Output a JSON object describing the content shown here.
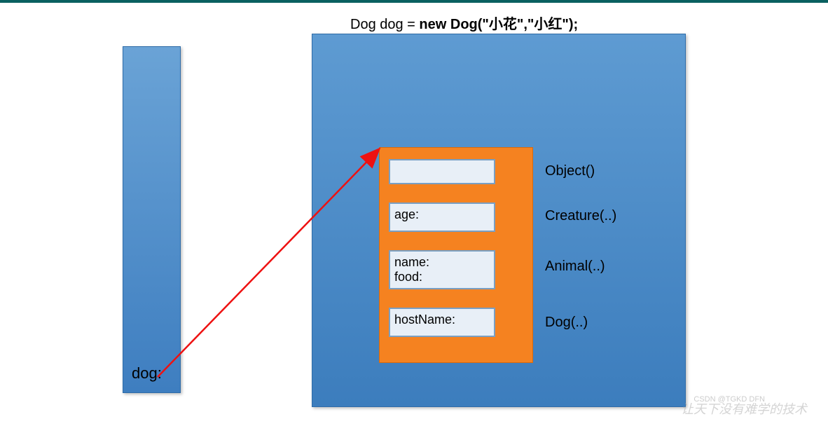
{
  "code": {
    "prefix": "Dog dog = ",
    "bold": "new Dog(\"小花\",\"小红\");"
  },
  "stack": {
    "label": "dog:"
  },
  "slots": {
    "s1": "",
    "s2": "age:",
    "s3": "name:\nfood:",
    "s4": "hostName:"
  },
  "labels": {
    "r1": "Object()",
    "r2": "Creature(..)",
    "r3": "Animal(..)",
    "r4": "Dog(..)"
  },
  "watermark": "让天下没有难学的技术",
  "watermark2": "CSDN @TGKD DFN"
}
